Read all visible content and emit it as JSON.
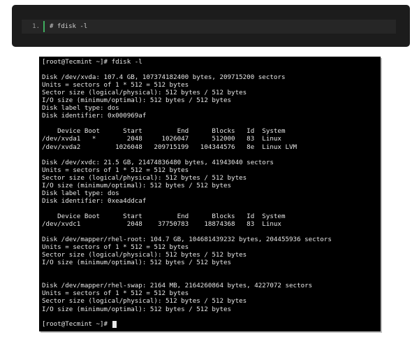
{
  "code_block": {
    "line_number": "1.",
    "command": "# fdisk -l"
  },
  "terminal": {
    "output": "[root@Tecmint ~]# fdisk -l\n\nDisk /dev/xvda: 107.4 GB, 107374182400 bytes, 209715200 sectors\nUnits = sectors of 1 * 512 = 512 bytes\nSector size (logical/physical): 512 bytes / 512 bytes\nI/O size (minimum/optimal): 512 bytes / 512 bytes\nDisk label type: dos\nDisk identifier: 0x000969af\n\n    Device Boot      Start         End      Blocks   Id  System\n/dev/xvda1   *        2048     1026047      512000   83  Linux\n/dev/xvda2         1026048   209715199   104344576   8e  Linux LVM\n\nDisk /dev/xvdc: 21.5 GB, 21474836480 bytes, 41943040 sectors\nUnits = sectors of 1 * 512 = 512 bytes\nSector size (logical/physical): 512 bytes / 512 bytes\nI/O size (minimum/optimal): 512 bytes / 512 bytes\nDisk label type: dos\nDisk identifier: 0xea4ddcaf\n\n    Device Boot      Start         End      Blocks   Id  System\n/dev/xvdc1            2048    37750783    18874368   83  Linux\n\nDisk /dev/mapper/rhel-root: 104.7 GB, 104681439232 bytes, 204455936 sectors\nUnits = sectors of 1 * 512 = 512 bytes\nSector size (logical/physical): 512 bytes / 512 bytes\nI/O size (minimum/optimal): 512 bytes / 512 bytes\n\n\nDisk /dev/mapper/rhel-swap: 2164 MB, 2164260864 bytes, 4227072 sectors\nUnits = sectors of 1 * 512 = 512 bytes\nSector size (logical/physical): 512 bytes / 512 bytes\nI/O size (minimum/optimal): 512 bytes / 512 bytes",
    "prompt": "[root@Tecmint ~]# "
  },
  "colors": {
    "code_background": "#1c1c1c",
    "gutter_accent": "#3fae5f",
    "terminal_background": "#000000",
    "terminal_text": "#e8e8e8"
  }
}
